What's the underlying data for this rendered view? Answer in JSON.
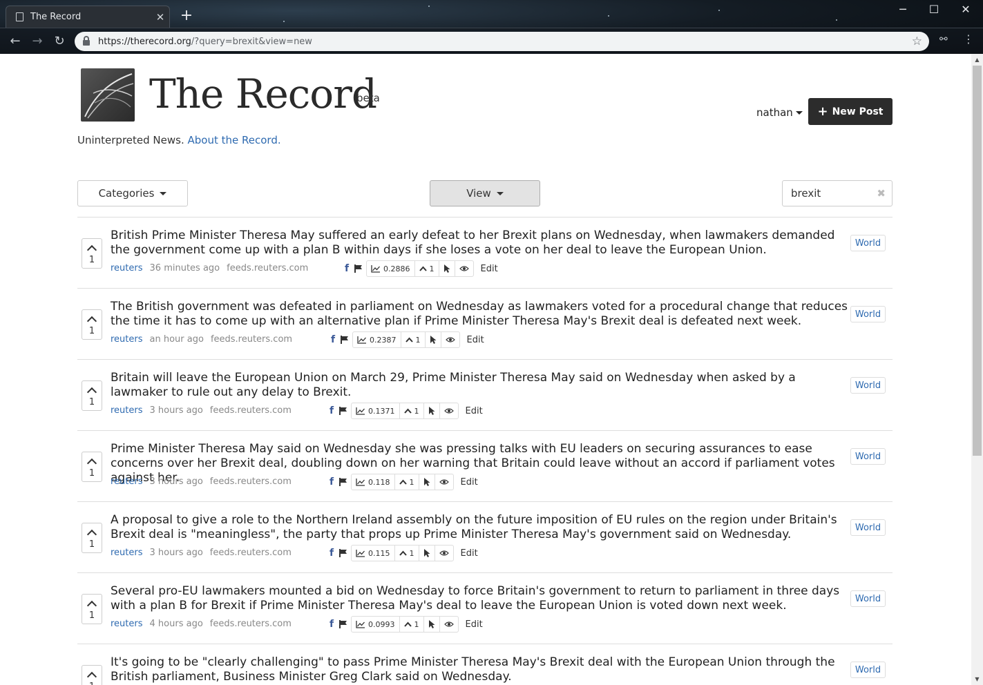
{
  "browser": {
    "tab_title": "The Record",
    "url_host": "https://therecord.org",
    "url_rest": "/?query=brexit&view=new"
  },
  "site": {
    "title": "The Record",
    "beta": "beta",
    "tagline": "Uninterpreted News.",
    "about_link": "About the Record."
  },
  "user": {
    "name": "nathan"
  },
  "new_post_label": "New Post",
  "filters": {
    "categories_label": "Categories",
    "view_label": "View",
    "search_value": "brexit"
  },
  "colors": {
    "link": "#2e6ab0",
    "dark_button": "#2c2c2c",
    "facebook": "#3b5998"
  },
  "items": [
    {
      "headline": "British Prime Minister Theresa May suffered an early defeat to her Brexit plans on Wednesday, when lawmakers demanded the government come up with a plan B within days if she loses a vote on her deal to leave the European Union.",
      "votes": "1",
      "source": "reuters",
      "time": "36 minutes ago",
      "domain": "feeds.reuters.com",
      "score": "0.2886",
      "upvotes": "1",
      "edit": "Edit",
      "category": "World"
    },
    {
      "headline": "The British government was defeated in parliament on Wednesday as lawmakers voted for a procedural change that reduces the time it has to come up with an alternative plan if Prime Minister Theresa May's Brexit deal is defeated next week.",
      "votes": "1",
      "source": "reuters",
      "time": "an hour ago",
      "domain": "feeds.reuters.com",
      "score": "0.2387",
      "upvotes": "1",
      "edit": "Edit",
      "category": "World"
    },
    {
      "headline": "Britain will leave the European Union on March 29, Prime Minister Theresa May said on Wednesday when asked by a lawmaker to rule out any delay to Brexit.",
      "votes": "1",
      "source": "reuters",
      "time": "3 hours ago",
      "domain": "feeds.reuters.com",
      "score": "0.1371",
      "upvotes": "1",
      "edit": "Edit",
      "category": "World"
    },
    {
      "headline": "Prime Minister Theresa May said on Wednesday she was pressing talks with EU leaders on securing assurances to ease concerns over her Brexit deal, doubling down on her warning that Britain could leave without an accord if parliament votes against her.",
      "votes": "1",
      "source": "reuters",
      "time": "3 hours ago",
      "domain": "feeds.reuters.com",
      "score": "0.118",
      "upvotes": "1",
      "edit": "Edit",
      "category": "World"
    },
    {
      "headline": "A proposal to give a role to the Northern Ireland assembly on the future imposition of EU rules on the region under Britain's Brexit deal is \"meaningless\", the party that props up Prime Minister Theresa May's government said on Wednesday.",
      "votes": "1",
      "source": "reuters",
      "time": "3 hours ago",
      "domain": "feeds.reuters.com",
      "score": "0.115",
      "upvotes": "1",
      "edit": "Edit",
      "category": "World"
    },
    {
      "headline": "Several pro-EU lawmakers mounted a bid on Wednesday to force Britain's government to return to parliament in three days with a plan B for Brexit if Prime Minister Theresa May's deal to leave the European Union is voted down next week.",
      "votes": "1",
      "source": "reuters",
      "time": "4 hours ago",
      "domain": "feeds.reuters.com",
      "score": "0.0993",
      "upvotes": "1",
      "edit": "Edit",
      "category": "World"
    },
    {
      "headline": "It's going to be \"clearly challenging\" to pass Prime Minister Theresa May's Brexit deal with the European Union through the British parliament, Business Minister Greg Clark said on Wednesday.",
      "votes": "1",
      "source": "",
      "time": "",
      "domain": "",
      "score": "",
      "upvotes": "",
      "edit": "",
      "category": "World"
    }
  ]
}
